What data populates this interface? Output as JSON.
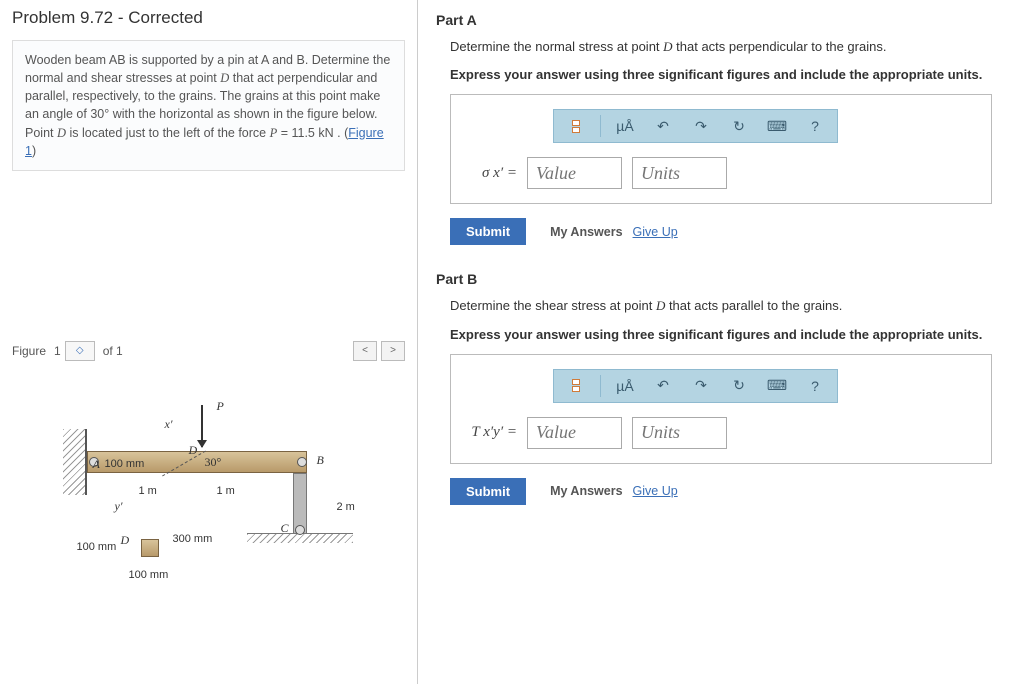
{
  "problem": {
    "title": "Problem 9.72 - Corrected",
    "statement_pre": "Wooden beam AB is supported by a pin at A and B. Determine the normal and shear stresses at point ",
    "statement_d": "D",
    "statement_mid": " that act perpendicular and parallel, respectively, to the grains. The grains at this point make an angle of 30° with the horizontal as shown in the figure below. Point ",
    "statement_post": " is located just to the left of the force ",
    "p_sym": "P",
    "p_eq": " = 11.5 kN . ",
    "fig_link_open": "(",
    "fig_link": "Figure 1",
    "fig_link_close": ")"
  },
  "figure_nav": {
    "label": "Figure",
    "current": "1",
    "of": "of 1"
  },
  "figure_labels": {
    "P": "P",
    "x": "x′",
    "y": "y′",
    "A": "A",
    "B": "B",
    "C": "C",
    "D": "D",
    "h100": "100 mm",
    "ang30": "30°",
    "d1m": "1 m",
    "d2m": "2 m",
    "h300": "300 mm",
    "w100": "100 mm"
  },
  "partA": {
    "heading": "Part A",
    "text_pre": "Determine the normal stress at point ",
    "text_d": "D",
    "text_post": " that acts perpendicular to the grains.",
    "instr": "Express your answer using three significant figures and include the appropriate units.",
    "sigma": "σ x′  =",
    "value_ph": "Value",
    "units_ph": "Units"
  },
  "partB": {
    "heading": "Part B",
    "text_pre": "Determine the shear stress at point ",
    "text_d": "D",
    "text_post": " that acts parallel to the grains.",
    "instr": "Express your answer using three significant figures and include the appropriate units.",
    "tau": "T x′y′  =",
    "value_ph": "Value",
    "units_ph": "Units"
  },
  "toolbar": {
    "units_hint": "µÅ"
  },
  "buttons": {
    "submit": "Submit",
    "myanswers": "My Answers",
    "giveup": "Give Up"
  }
}
